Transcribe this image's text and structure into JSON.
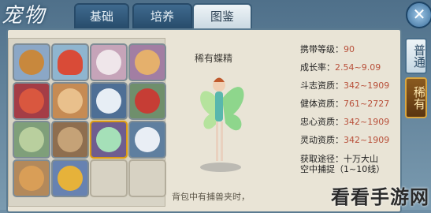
{
  "window": {
    "title_art": "宠物"
  },
  "tabs": [
    {
      "label": "基础",
      "active": false
    },
    {
      "label": "培养",
      "active": false
    },
    {
      "label": "图鉴",
      "active": true
    }
  ],
  "pet": {
    "name": "稀有蝶精",
    "stats": [
      {
        "label": "携带等级：",
        "value": "90"
      },
      {
        "label": "成长率：",
        "value": "2.54~9.09"
      },
      {
        "label": "斗志资质：",
        "value": "342~1909"
      },
      {
        "label": "健体资质：",
        "value": "761~2727"
      },
      {
        "label": "忠心资质：",
        "value": "342~1909"
      },
      {
        "label": "灵动资质：",
        "value": "342~1909"
      }
    ],
    "source_label": "获取途径：",
    "source_line1": "十万大山",
    "source_line2": "空中捕捉（1~10线）"
  },
  "side_buttons": {
    "normal": "普通",
    "rare": "稀有"
  },
  "hint": "背包中有捕兽夹时，",
  "watermark": "看看手游网",
  "colors": {
    "accent": "#d99a17",
    "stat_value": "#b8503a",
    "tab_dark": "#274c6b"
  },
  "icons": [
    "close-icon"
  ]
}
